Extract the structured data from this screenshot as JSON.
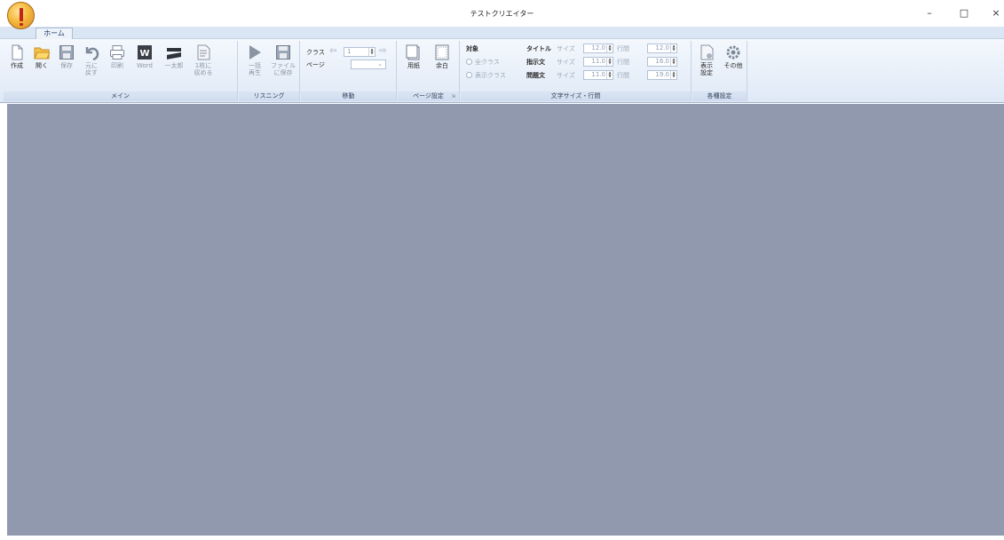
{
  "window": {
    "title": "テストクリエイター",
    "minimize_label": "–",
    "maximize_label": "□",
    "close_label": "×"
  },
  "tabs": [
    {
      "label": "ホーム",
      "active": true
    }
  ],
  "ribbon": {
    "main": {
      "label": "メイン",
      "buttons": [
        {
          "label": "作成",
          "icon": "new-document-icon",
          "enabled": true
        },
        {
          "label": "開く",
          "icon": "open-folder-icon",
          "enabled": true
        },
        {
          "label": "保存",
          "icon": "save-icon",
          "enabled": false
        },
        {
          "label": "元に\n戻す",
          "icon": "undo-icon",
          "enabled": false
        },
        {
          "label": "印刷",
          "icon": "print-icon",
          "enabled": false
        },
        {
          "label": "Word",
          "icon": "word-icon",
          "enabled": false
        },
        {
          "label": "一太郎",
          "icon": "ichitaro-icon",
          "enabled": false
        },
        {
          "label": "1枚に\n収める",
          "icon": "fit-page-icon",
          "enabled": false
        }
      ]
    },
    "listening": {
      "label": "リスニング",
      "buttons": [
        {
          "label": "一括\n再生",
          "icon": "play-icon",
          "enabled": false
        },
        {
          "label": "ファイル\nに保存",
          "icon": "save-file-icon",
          "enabled": false
        }
      ]
    },
    "navigation": {
      "label": "移動",
      "class_label": "クラス",
      "page_label": "ページ",
      "class_value": "1"
    },
    "page_setup": {
      "label": "ページ設定",
      "buttons": [
        {
          "label": "用紙",
          "icon": "paper-icon"
        },
        {
          "label": "余白",
          "icon": "margin-icon"
        }
      ]
    },
    "font_size": {
      "label": "文字サイズ・行間",
      "target_label": "対象",
      "radio_all": "全クラス",
      "radio_display": "表示クラス",
      "size_label": "サイズ",
      "spacing_label": "行間",
      "rows": [
        {
          "name": "タイトル",
          "size": "12.0",
          "spacing": "12.0"
        },
        {
          "name": "指示文",
          "size": "11.0",
          "spacing": "16.0"
        },
        {
          "name": "問題文",
          "size": "11.0",
          "spacing": "19.0"
        }
      ]
    },
    "settings": {
      "label": "各種設定",
      "buttons": [
        {
          "label": "表示\n設定",
          "icon": "display-settings-icon"
        },
        {
          "label": "その他",
          "icon": "gear-icon"
        }
      ]
    }
  }
}
